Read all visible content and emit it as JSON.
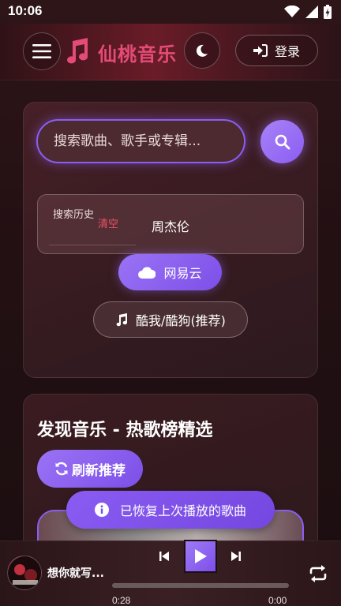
{
  "status_bar": {
    "time": "10:06"
  },
  "header": {
    "app_title": "仙桃音乐",
    "login_label": "登录",
    "icons": {
      "menu": "hamburger-menu-icon",
      "logo": "music-note-icon",
      "theme": "moon-icon",
      "login": "sign-in-icon"
    }
  },
  "search": {
    "placeholder": "搜索歌曲、歌手或专辑...",
    "value": "",
    "history_label": "搜索历史",
    "clear_label": "清空",
    "history_items": [
      "周杰伦"
    ]
  },
  "sources": [
    {
      "label": "网易云",
      "icon": "cloud-icon",
      "selected": true
    },
    {
      "label": "酷我/酷狗(推荐)",
      "icon": "music-note-icon",
      "selected": false
    }
  ],
  "discover": {
    "title": "发现音乐 - 热歌榜精选",
    "refresh_label": "刷新推荐"
  },
  "toast": {
    "message": "已恢复上次播放的歌曲"
  },
  "player": {
    "song_title": "想你就写...",
    "current_time": "0:28",
    "total_time": "0:00"
  },
  "colors": {
    "accent": "#8c5cf2",
    "brand": "#e54b78",
    "clear": "#f05068"
  }
}
